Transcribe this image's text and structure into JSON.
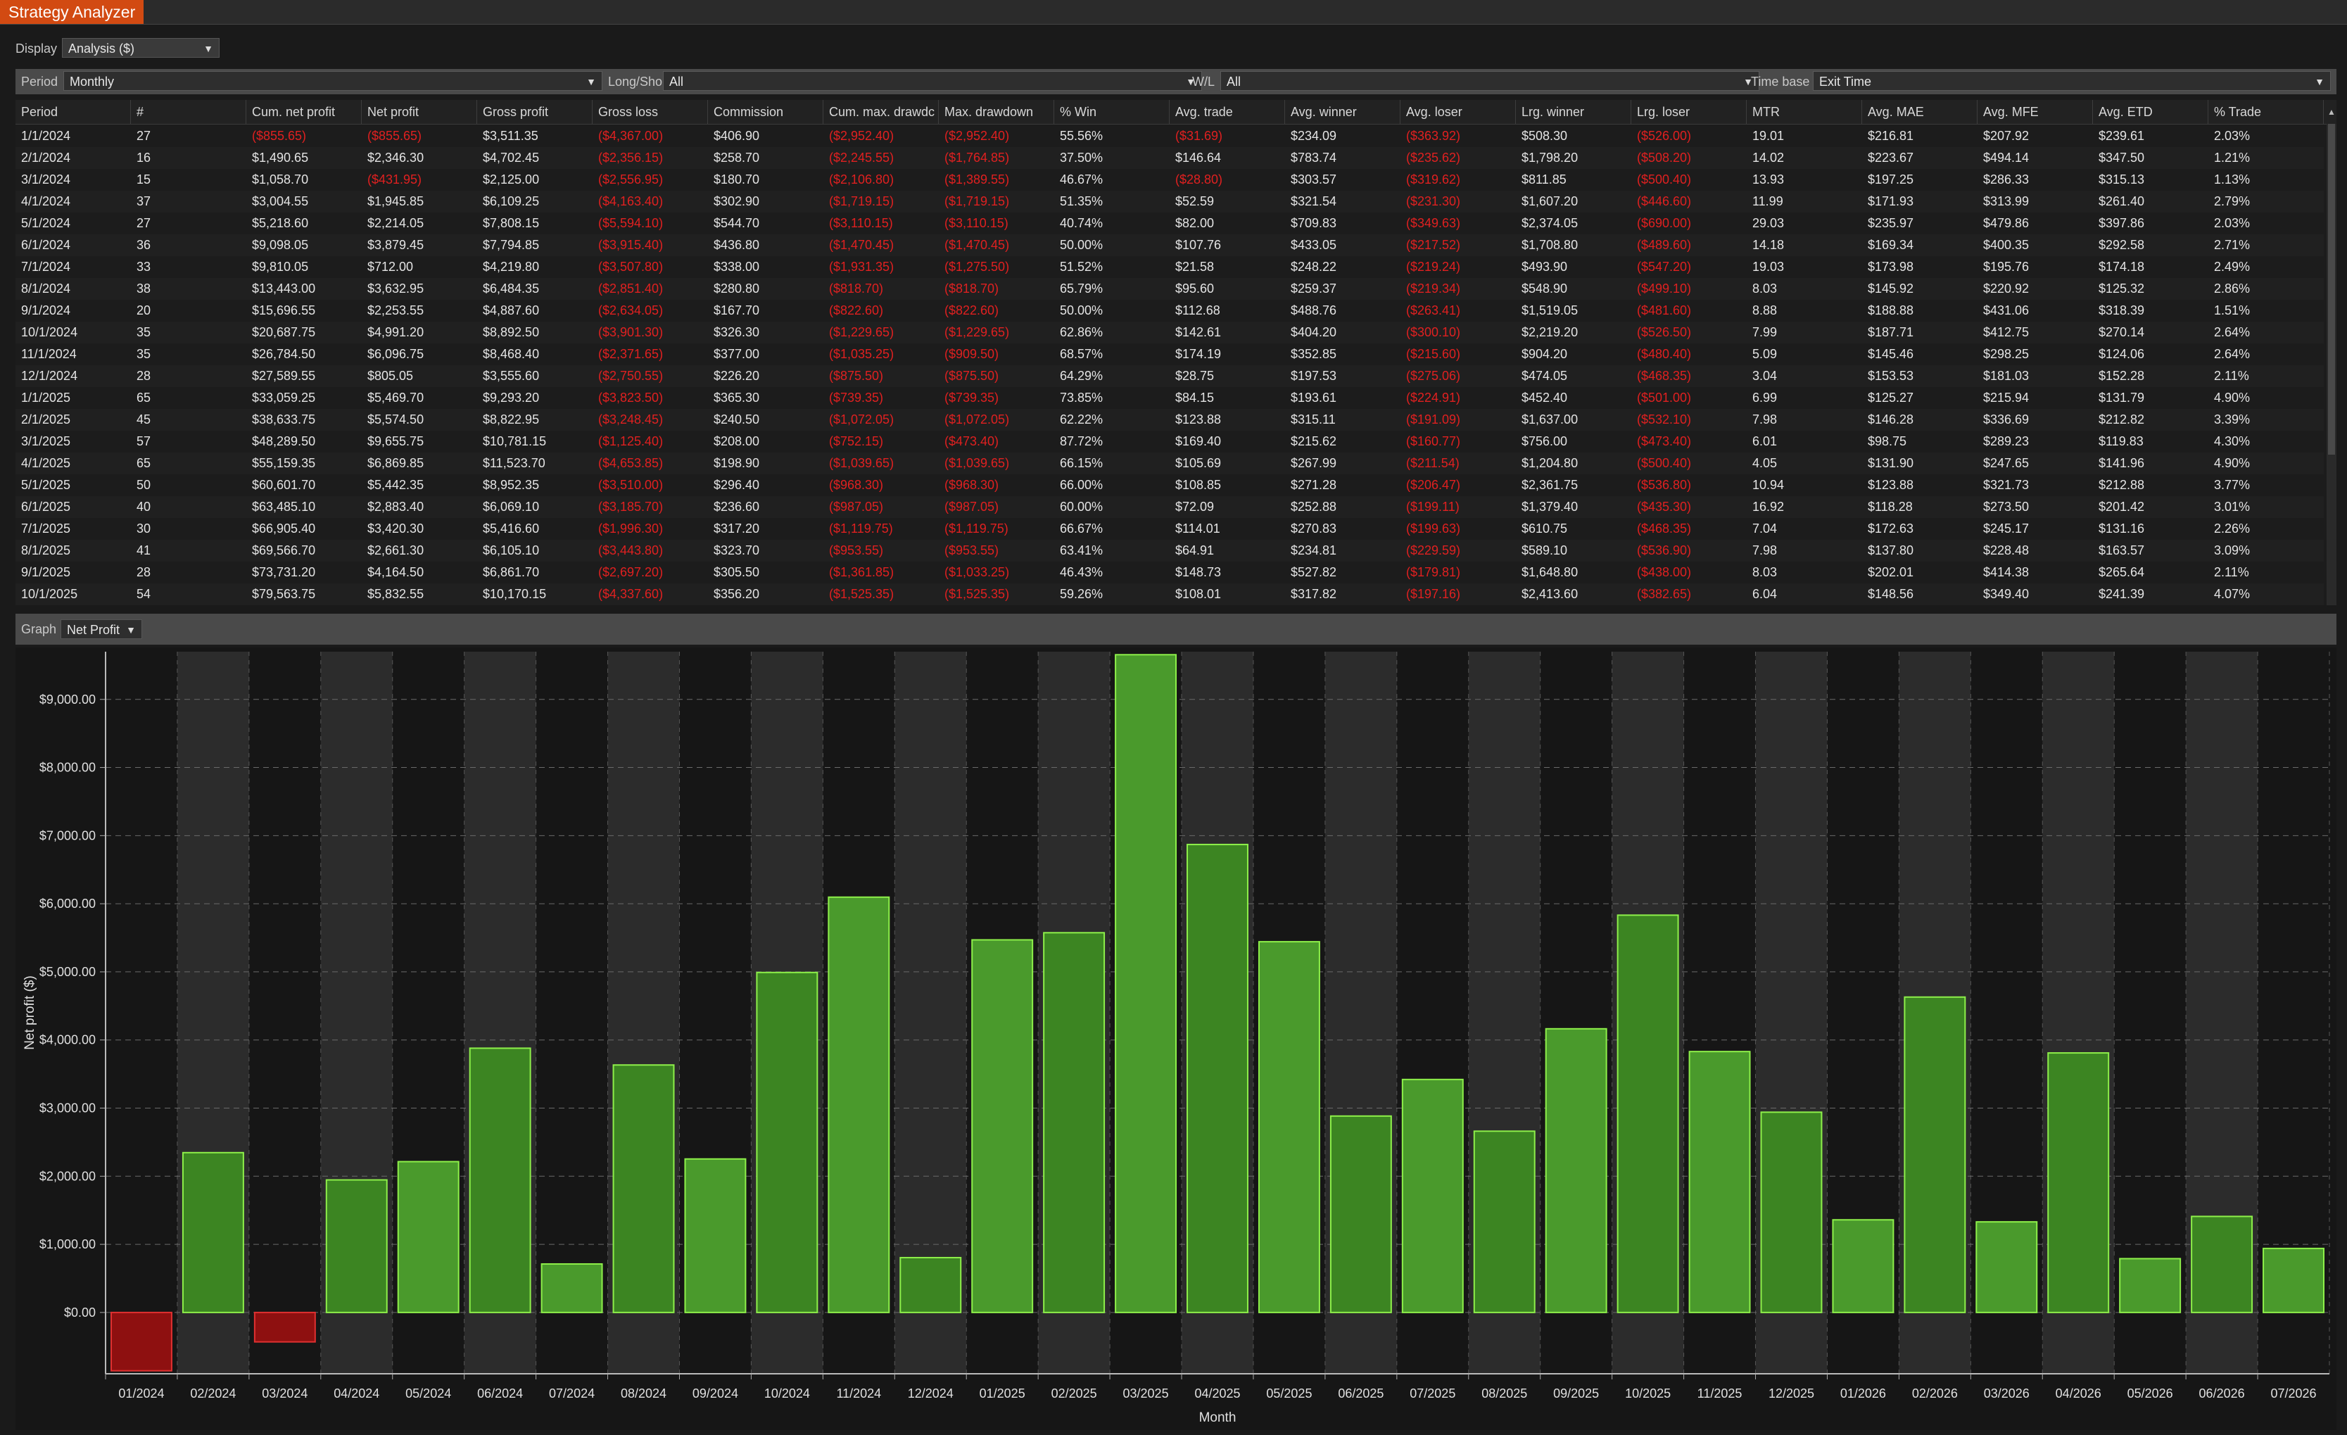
{
  "window": {
    "title": "Strategy Analyzer"
  },
  "display": {
    "label": "Display",
    "value": "Analysis ($)"
  },
  "filters": {
    "period_label": "Period",
    "period_value": "Monthly",
    "longshort_label": "Long/Short",
    "longshort_value": "All",
    "wl_label": "W/L",
    "wl_value": "All",
    "timebase_label": "Time base",
    "timebase_value": "Exit Time"
  },
  "table": {
    "columns": [
      "Period",
      "#",
      "Cum. net profit",
      "Net profit",
      "Gross profit",
      "Gross loss",
      "Commission",
      "Cum. max. drawdc",
      "Max. drawdown",
      "% Win",
      "Avg. trade",
      "Avg. winner",
      "Avg. loser",
      "Lrg. winner",
      "Lrg. loser",
      "MTR",
      "Avg. MAE",
      "Avg. MFE",
      "Avg. ETD",
      "% Trade"
    ],
    "rows": [
      [
        "1/1/2024",
        "27",
        "($855.65)",
        "($855.65)",
        "$3,511.35",
        "($4,367.00)",
        "$406.90",
        "($2,952.40)",
        "($2,952.40)",
        "55.56%",
        "($31.69)",
        "$234.09",
        "($363.92)",
        "$508.30",
        "($526.00)",
        "19.01",
        "$216.81",
        "$207.92",
        "$239.61",
        "2.03%"
      ],
      [
        "2/1/2024",
        "16",
        "$1,490.65",
        "$2,346.30",
        "$4,702.45",
        "($2,356.15)",
        "$258.70",
        "($2,245.55)",
        "($1,764.85)",
        "37.50%",
        "$146.64",
        "$783.74",
        "($235.62)",
        "$1,798.20",
        "($508.20)",
        "14.02",
        "$223.67",
        "$494.14",
        "$347.50",
        "1.21%"
      ],
      [
        "3/1/2024",
        "15",
        "$1,058.70",
        "($431.95)",
        "$2,125.00",
        "($2,556.95)",
        "$180.70",
        "($2,106.80)",
        "($1,389.55)",
        "46.67%",
        "($28.80)",
        "$303.57",
        "($319.62)",
        "$811.85",
        "($500.40)",
        "13.93",
        "$197.25",
        "$286.33",
        "$315.13",
        "1.13%"
      ],
      [
        "4/1/2024",
        "37",
        "$3,004.55",
        "$1,945.85",
        "$6,109.25",
        "($4,163.40)",
        "$302.90",
        "($1,719.15)",
        "($1,719.15)",
        "51.35%",
        "$52.59",
        "$321.54",
        "($231.30)",
        "$1,607.20",
        "($446.60)",
        "11.99",
        "$171.93",
        "$313.99",
        "$261.40",
        "2.79%"
      ],
      [
        "5/1/2024",
        "27",
        "$5,218.60",
        "$2,214.05",
        "$7,808.15",
        "($5,594.10)",
        "$544.70",
        "($3,110.15)",
        "($3,110.15)",
        "40.74%",
        "$82.00",
        "$709.83",
        "($349.63)",
        "$2,374.05",
        "($690.00)",
        "29.03",
        "$235.97",
        "$479.86",
        "$397.86",
        "2.03%"
      ],
      [
        "6/1/2024",
        "36",
        "$9,098.05",
        "$3,879.45",
        "$7,794.85",
        "($3,915.40)",
        "$436.80",
        "($1,470.45)",
        "($1,470.45)",
        "50.00%",
        "$107.76",
        "$433.05",
        "($217.52)",
        "$1,708.80",
        "($489.60)",
        "14.18",
        "$169.34",
        "$400.35",
        "$292.58",
        "2.71%"
      ],
      [
        "7/1/2024",
        "33",
        "$9,810.05",
        "$712.00",
        "$4,219.80",
        "($3,507.80)",
        "$338.00",
        "($1,931.35)",
        "($1,275.50)",
        "51.52%",
        "$21.58",
        "$248.22",
        "($219.24)",
        "$493.90",
        "($547.20)",
        "19.03",
        "$173.98",
        "$195.76",
        "$174.18",
        "2.49%"
      ],
      [
        "8/1/2024",
        "38",
        "$13,443.00",
        "$3,632.95",
        "$6,484.35",
        "($2,851.40)",
        "$280.80",
        "($818.70)",
        "($818.70)",
        "65.79%",
        "$95.60",
        "$259.37",
        "($219.34)",
        "$548.90",
        "($499.10)",
        "8.03",
        "$145.92",
        "$220.92",
        "$125.32",
        "2.86%"
      ],
      [
        "9/1/2024",
        "20",
        "$15,696.55",
        "$2,253.55",
        "$4,887.60",
        "($2,634.05)",
        "$167.70",
        "($822.60)",
        "($822.60)",
        "50.00%",
        "$112.68",
        "$488.76",
        "($263.41)",
        "$1,519.05",
        "($481.60)",
        "8.88",
        "$188.88",
        "$431.06",
        "$318.39",
        "1.51%"
      ],
      [
        "10/1/2024",
        "35",
        "$20,687.75",
        "$4,991.20",
        "$8,892.50",
        "($3,901.30)",
        "$326.30",
        "($1,229.65)",
        "($1,229.65)",
        "62.86%",
        "$142.61",
        "$404.20",
        "($300.10)",
        "$2,219.20",
        "($526.50)",
        "7.99",
        "$187.71",
        "$412.75",
        "$270.14",
        "2.64%"
      ],
      [
        "11/1/2024",
        "35",
        "$26,784.50",
        "$6,096.75",
        "$8,468.40",
        "($2,371.65)",
        "$377.00",
        "($1,035.25)",
        "($909.50)",
        "68.57%",
        "$174.19",
        "$352.85",
        "($215.60)",
        "$904.20",
        "($480.40)",
        "5.09",
        "$145.46",
        "$298.25",
        "$124.06",
        "2.64%"
      ],
      [
        "12/1/2024",
        "28",
        "$27,589.55",
        "$805.05",
        "$3,555.60",
        "($2,750.55)",
        "$226.20",
        "($875.50)",
        "($875.50)",
        "64.29%",
        "$28.75",
        "$197.53",
        "($275.06)",
        "$474.05",
        "($468.35)",
        "3.04",
        "$153.53",
        "$181.03",
        "$152.28",
        "2.11%"
      ],
      [
        "1/1/2025",
        "65",
        "$33,059.25",
        "$5,469.70",
        "$9,293.20",
        "($3,823.50)",
        "$365.30",
        "($739.35)",
        "($739.35)",
        "73.85%",
        "$84.15",
        "$193.61",
        "($224.91)",
        "$452.40",
        "($501.00)",
        "6.99",
        "$125.27",
        "$215.94",
        "$131.79",
        "4.90%"
      ],
      [
        "2/1/2025",
        "45",
        "$38,633.75",
        "$5,574.50",
        "$8,822.95",
        "($3,248.45)",
        "$240.50",
        "($1,072.05)",
        "($1,072.05)",
        "62.22%",
        "$123.88",
        "$315.11",
        "($191.09)",
        "$1,637.00",
        "($532.10)",
        "7.98",
        "$146.28",
        "$336.69",
        "$212.82",
        "3.39%"
      ],
      [
        "3/1/2025",
        "57",
        "$48,289.50",
        "$9,655.75",
        "$10,781.15",
        "($1,125.40)",
        "$208.00",
        "($752.15)",
        "($473.40)",
        "87.72%",
        "$169.40",
        "$215.62",
        "($160.77)",
        "$756.00",
        "($473.40)",
        "6.01",
        "$98.75",
        "$289.23",
        "$119.83",
        "4.30%"
      ],
      [
        "4/1/2025",
        "65",
        "$55,159.35",
        "$6,869.85",
        "$11,523.70",
        "($4,653.85)",
        "$198.90",
        "($1,039.65)",
        "($1,039.65)",
        "66.15%",
        "$105.69",
        "$267.99",
        "($211.54)",
        "$1,204.80",
        "($500.40)",
        "4.05",
        "$131.90",
        "$247.65",
        "$141.96",
        "4.90%"
      ],
      [
        "5/1/2025",
        "50",
        "$60,601.70",
        "$5,442.35",
        "$8,952.35",
        "($3,510.00)",
        "$296.40",
        "($968.30)",
        "($968.30)",
        "66.00%",
        "$108.85",
        "$271.28",
        "($206.47)",
        "$2,361.75",
        "($536.80)",
        "10.94",
        "$123.88",
        "$321.73",
        "$212.88",
        "3.77%"
      ],
      [
        "6/1/2025",
        "40",
        "$63,485.10",
        "$2,883.40",
        "$6,069.10",
        "($3,185.70)",
        "$236.60",
        "($987.05)",
        "($987.05)",
        "60.00%",
        "$72.09",
        "$252.88",
        "($199.11)",
        "$1,379.40",
        "($435.30)",
        "16.92",
        "$118.28",
        "$273.50",
        "$201.42",
        "3.01%"
      ],
      [
        "7/1/2025",
        "30",
        "$66,905.40",
        "$3,420.30",
        "$5,416.60",
        "($1,996.30)",
        "$317.20",
        "($1,119.75)",
        "($1,119.75)",
        "66.67%",
        "$114.01",
        "$270.83",
        "($199.63)",
        "$610.75",
        "($468.35)",
        "7.04",
        "$172.63",
        "$245.17",
        "$131.16",
        "2.26%"
      ],
      [
        "8/1/2025",
        "41",
        "$69,566.70",
        "$2,661.30",
        "$6,105.10",
        "($3,443.80)",
        "$323.70",
        "($953.55)",
        "($953.55)",
        "63.41%",
        "$64.91",
        "$234.81",
        "($229.59)",
        "$589.10",
        "($536.90)",
        "7.98",
        "$137.80",
        "$228.48",
        "$163.57",
        "3.09%"
      ],
      [
        "9/1/2025",
        "28",
        "$73,731.20",
        "$4,164.50",
        "$6,861.70",
        "($2,697.20)",
        "$305.50",
        "($1,361.85)",
        "($1,033.25)",
        "46.43%",
        "$148.73",
        "$527.82",
        "($179.81)",
        "$1,648.80",
        "($438.00)",
        "8.03",
        "$202.01",
        "$414.38",
        "$265.64",
        "2.11%"
      ],
      [
        "10/1/2025",
        "54",
        "$79,563.75",
        "$5,832.55",
        "$10,170.15",
        "($4,337.60)",
        "$356.20",
        "($1,525.35)",
        "($1,525.35)",
        "59.26%",
        "$108.01",
        "$317.82",
        "($197.16)",
        "$2,413.60",
        "($382.65)",
        "6.04",
        "$148.56",
        "$349.40",
        "$241.39",
        "4.07%"
      ]
    ]
  },
  "graph": {
    "label": "Graph",
    "value": "Net Profit"
  },
  "chart_data": {
    "type": "bar",
    "xlabel": "Month",
    "ylabel": "Net profit ($)",
    "ylim": [
      -900,
      9700
    ],
    "yticks": [
      "$0.00",
      "$1,000.00",
      "$2,000.00",
      "$3,000.00",
      "$4,000.00",
      "$5,000.00",
      "$6,000.00",
      "$7,000.00",
      "$8,000.00",
      "$9,000.00"
    ],
    "categories": [
      "01/2024",
      "02/2024",
      "03/2024",
      "04/2024",
      "05/2024",
      "06/2024",
      "07/2024",
      "08/2024",
      "09/2024",
      "10/2024",
      "11/2024",
      "12/2024",
      "01/2025",
      "02/2025",
      "03/2025",
      "04/2025",
      "05/2025",
      "06/2025",
      "07/2025",
      "08/2025",
      "09/2025",
      "10/2025",
      "11/2025",
      "12/2025",
      "01/2026",
      "02/2026",
      "03/2026",
      "04/2026",
      "05/2026",
      "06/2026",
      "07/2026"
    ],
    "values": [
      -855.65,
      2346.3,
      -431.95,
      1945.85,
      2214.05,
      3879.45,
      712.0,
      3632.95,
      2253.55,
      4991.2,
      6096.75,
      805.05,
      5469.7,
      5574.5,
      9655.75,
      6869.85,
      5442.35,
      2883.4,
      3420.3,
      2661.3,
      4164.5,
      5832.55,
      3830,
      2940,
      1360,
      4630,
      1330,
      3810,
      790,
      1410,
      940
    ],
    "positive_color": "#3f8a22",
    "negative_color": "#8e1010",
    "grid": true
  }
}
